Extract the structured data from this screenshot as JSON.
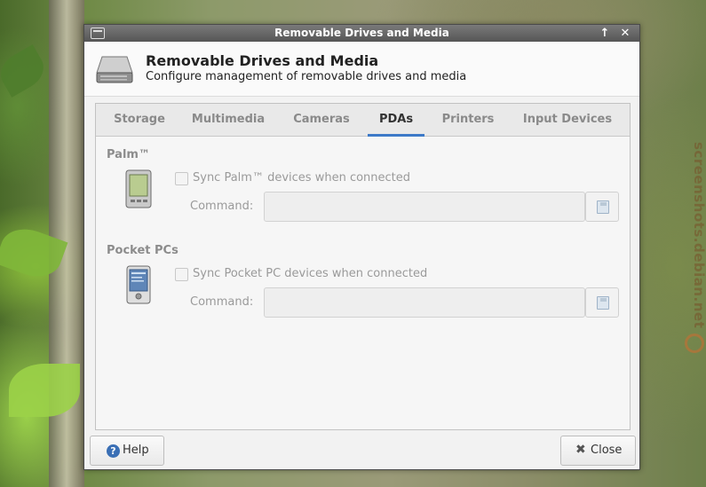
{
  "window": {
    "title": "Removable Drives and Media"
  },
  "header": {
    "title": "Removable Drives and Media",
    "subtitle": "Configure management of removable drives and media"
  },
  "tabs": [
    {
      "label": "Storage"
    },
    {
      "label": "Multimedia"
    },
    {
      "label": "Cameras"
    },
    {
      "label": "PDAs",
      "active": true
    },
    {
      "label": "Printers"
    },
    {
      "label": "Input Devices"
    }
  ],
  "palm": {
    "heading": "Palm™",
    "sync_label": "Sync Palm™ devices when connected",
    "sync_checked": false,
    "command_label": "Command:",
    "command_value": ""
  },
  "pocketpc": {
    "heading": "Pocket PCs",
    "sync_label": "Sync Pocket PC devices when connected",
    "sync_checked": false,
    "command_label": "Command:",
    "command_value": ""
  },
  "buttons": {
    "help": "Help",
    "close": "Close"
  },
  "watermark": "screenshots.debian.net",
  "icons": {
    "window_menu": "window-menu-icon",
    "maximize": "arrow-up-icon",
    "close": "close-x-icon",
    "drive": "removable-drive-icon",
    "palm": "palm-device-icon",
    "pocketpc": "pocket-pc-icon",
    "browse": "document-open-icon",
    "help": "help-icon"
  },
  "colors": {
    "active_tab_underline": "#3d7ac8",
    "titlebar": "#5c5c5c"
  }
}
